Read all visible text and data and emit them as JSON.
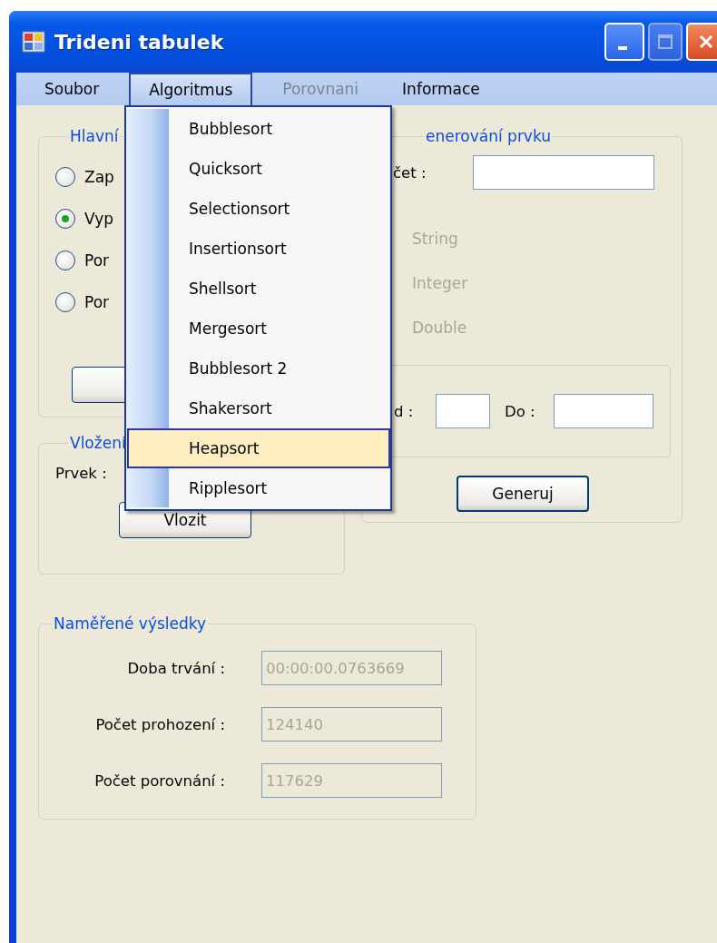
{
  "window": {
    "title": "Trideni tabulek"
  },
  "menu_bar": [
    {
      "label": "Soubor",
      "selected": false,
      "disabled": false
    },
    {
      "label": "Algoritmus",
      "selected": true,
      "disabled": false
    },
    {
      "label": "Porovnani",
      "selected": false,
      "disabled": true
    },
    {
      "label": "Informace",
      "selected": false,
      "disabled": false
    }
  ],
  "dropdown": [
    {
      "label": "Bubblesort",
      "selected": false
    },
    {
      "label": "Quicksort",
      "selected": false
    },
    {
      "label": "Selectionsort",
      "selected": false
    },
    {
      "label": "Insertionsort",
      "selected": false
    },
    {
      "label": "Shellsort",
      "selected": false
    },
    {
      "label": "Mergesort",
      "selected": false
    },
    {
      "label": "Bubblesort 2",
      "selected": false
    },
    {
      "label": "Shakersort",
      "selected": false
    },
    {
      "label": "Heapsort",
      "selected": true
    },
    {
      "label": "Ripplesort",
      "selected": false
    }
  ],
  "hlavni": {
    "title": "Hlavní",
    "options": [
      {
        "label": "Zap",
        "selected": false
      },
      {
        "label": "Vyp",
        "selected": true
      },
      {
        "label": "Por",
        "selected": false
      },
      {
        "label": "Por",
        "selected": false
      }
    ]
  },
  "vlozeni": {
    "title": "Vložení",
    "label": "Prvek :",
    "button": "Vlozit"
  },
  "generovani": {
    "title": "enerování prvku",
    "count_label": "čet :",
    "types": [
      {
        "label": "String",
        "disabled": true
      },
      {
        "label": "Integer",
        "disabled": true
      },
      {
        "label": "Double",
        "disabled": true
      }
    ],
    "from_label": "d :",
    "to_label": "Do :",
    "button": "Generuj"
  },
  "results": {
    "title": "Naměřené výsledky",
    "rows": [
      {
        "label": "Doba trvání :",
        "value": "00:00:00.0763669",
        "disabled": true
      },
      {
        "label": "Počet prohození :",
        "value": "124140",
        "disabled": true
      },
      {
        "label": "Počet porovnání :",
        "value": "117629",
        "disabled": true
      }
    ]
  }
}
